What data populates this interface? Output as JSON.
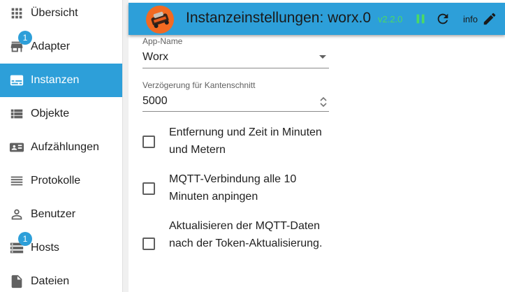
{
  "sidebar": {
    "items": [
      {
        "label": "Übersicht",
        "icon": "apps-grid-icon",
        "badge": null,
        "selected": false
      },
      {
        "label": "Adapter",
        "icon": "store-icon",
        "badge": "1",
        "selected": false
      },
      {
        "label": "Instanzen",
        "icon": "subtitles-icon",
        "badge": null,
        "selected": true
      },
      {
        "label": "Objekte",
        "icon": "list-icon",
        "badge": null,
        "selected": false
      },
      {
        "label": "Aufzählungen",
        "icon": "contact-card-icon",
        "badge": null,
        "selected": false
      },
      {
        "label": "Protokolle",
        "icon": "menu-lines-icon",
        "badge": null,
        "selected": false
      },
      {
        "label": "Benutzer",
        "icon": "person-icon",
        "badge": null,
        "selected": false
      },
      {
        "label": "Hosts",
        "icon": "storage-icon",
        "badge": "1",
        "selected": false
      },
      {
        "label": "Dateien",
        "icon": "file-icon",
        "badge": null,
        "selected": false
      }
    ]
  },
  "header": {
    "title": "Instanzeinstellungen: worx.0",
    "version": "v2.2.0",
    "info_label": "info"
  },
  "form": {
    "app_name": {
      "label": "App-Name",
      "value": "Worx"
    },
    "delay": {
      "label": "Verzögerung für Kantenschnitt",
      "value": "5000"
    },
    "checkboxes": [
      {
        "label": "Entfernung und Zeit in Minuten und Metern",
        "checked": false
      },
      {
        "label": "MQTT-Verbindung alle 10 Minuten anpingen",
        "checked": false
      },
      {
        "label": "Aktualisieren der MQTT-Daten nach der Token-Aktualisierung.",
        "checked": false
      }
    ]
  },
  "colors": {
    "accent": "#2d9fd9",
    "version_green": "#4cd964",
    "pause_green": "#4cd964",
    "logo_orange": "#f26a22"
  }
}
